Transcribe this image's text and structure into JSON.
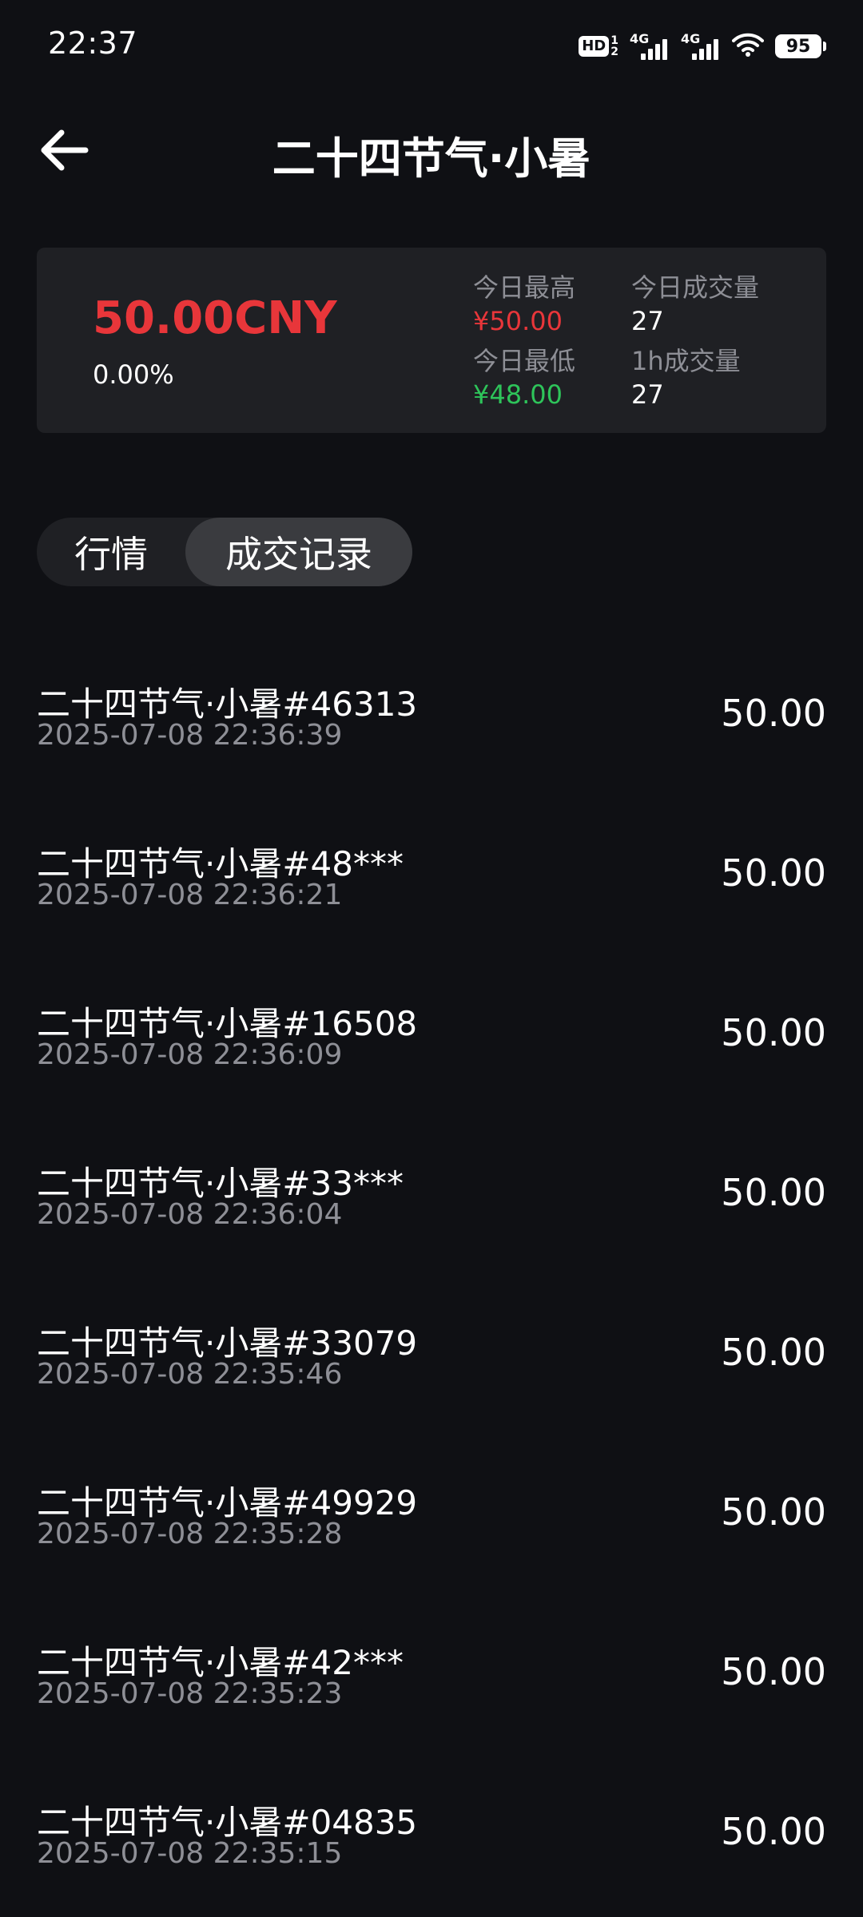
{
  "status_bar": {
    "time": "22:37",
    "hd_label": "HD",
    "hd_sub_top": "1",
    "hd_sub_bottom": "2",
    "network_1": "4G",
    "network_2": "4G",
    "battery": "95",
    "icons": [
      "hd-icon",
      "signal-icon",
      "signal-icon",
      "wifi-icon",
      "battery-icon"
    ]
  },
  "header": {
    "back_icon": "arrow-left-icon",
    "title": "二十四节气·小暑"
  },
  "summary": {
    "price": "50.00CNY",
    "change": "0.00%",
    "high_label": "今日最高",
    "high_value": "¥50.00",
    "volume_label": "今日成交量",
    "volume_value": "27",
    "low_label": "今日最低",
    "low_value": "¥48.00",
    "volume_1h_label": "1h成交量",
    "volume_1h_value": "27",
    "colors": {
      "price": "#e8363a",
      "high": "#e8363a",
      "low": "#2ec45a"
    }
  },
  "tabs": {
    "market": "行情",
    "trades": "成交记录",
    "active": "trades"
  },
  "trades": [
    {
      "name": "二十四节气·小暑#46313",
      "time": "2025-07-08 22:36:39",
      "price": "50.00"
    },
    {
      "name": "二十四节气·小暑#48***",
      "time": "2025-07-08 22:36:21",
      "price": "50.00"
    },
    {
      "name": "二十四节气·小暑#16508",
      "time": "2025-07-08 22:36:09",
      "price": "50.00"
    },
    {
      "name": "二十四节气·小暑#33***",
      "time": "2025-07-08 22:36:04",
      "price": "50.00"
    },
    {
      "name": "二十四节气·小暑#33079",
      "time": "2025-07-08 22:35:46",
      "price": "50.00"
    },
    {
      "name": "二十四节气·小暑#49929",
      "time": "2025-07-08 22:35:28",
      "price": "50.00"
    },
    {
      "name": "二十四节气·小暑#42***",
      "time": "2025-07-08 22:35:23",
      "price": "50.00"
    },
    {
      "name": "二十四节气·小暑#04835",
      "time": "2025-07-08 22:35:15",
      "price": "50.00"
    }
  ]
}
